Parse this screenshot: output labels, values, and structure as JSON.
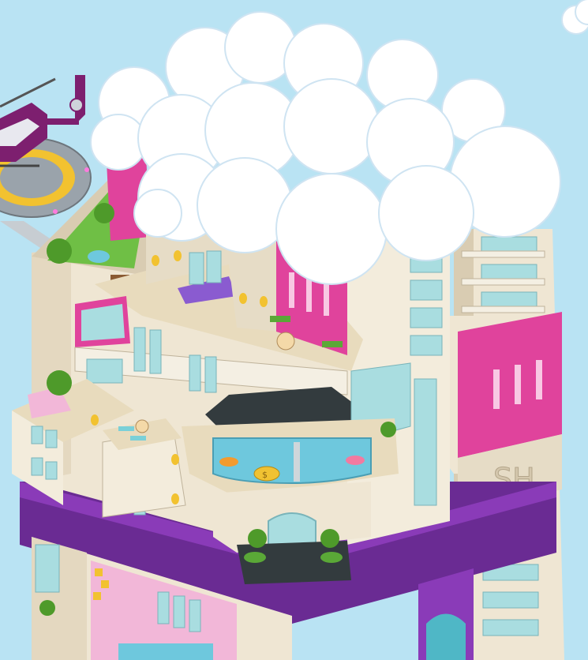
{
  "scene": {
    "building_monogram": "SH",
    "coin_label": "$",
    "palette": {
      "sky": "#b9e3f3",
      "cloud": "#ffffff",
      "cloud_shade": "#d7eaf6",
      "facade": "#efe6d3",
      "facade_shade": "#d9ccb2",
      "magenta": "#e0439c",
      "purple": "#6a2b93",
      "glass": "#a9dde0",
      "pool": "#6ec8dd",
      "grass": "#6fbf45",
      "tree": "#4e9a2a",
      "helicopter": "#7d1f6f",
      "helipad": "#9aa3ab",
      "helipad_mark": "#f2c230",
      "coin": "#f0c232"
    }
  }
}
